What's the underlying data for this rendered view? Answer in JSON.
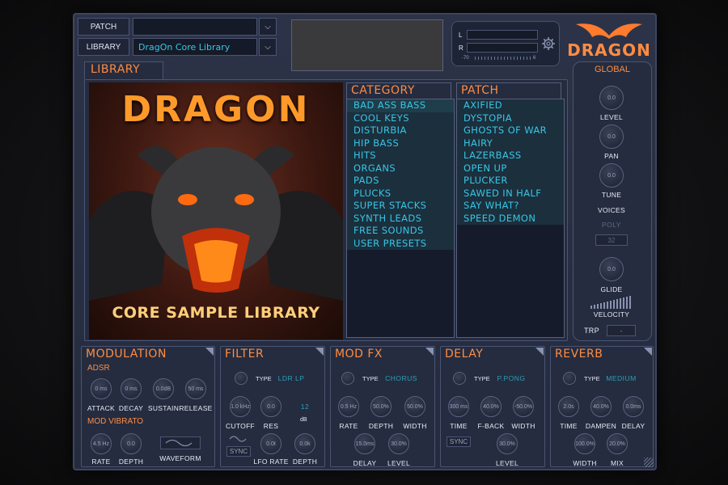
{
  "header": {
    "patch_label": "PATCH",
    "library_label": "LIBRARY",
    "patch_value": "",
    "library_value": "DragOn Core Library",
    "dropdown_glyph": "⌵",
    "meter_L": "L",
    "meter_R": "R",
    "meter_scale_low": "-70",
    "meter_scale_high": "6",
    "logo_text": "DRAGON"
  },
  "library": {
    "section_title": "LIBRARY",
    "artwork_title": "DRAGON",
    "artwork_caption": "CORE SAMPLE LIBRARY"
  },
  "category": {
    "title": "CATEGORY",
    "items": [
      "BAD ASS BASS",
      "COOL KEYS",
      "DISTURBIA",
      "HIP BASS",
      "HITS",
      "ORGANS",
      "PADS",
      "PLUCKS",
      "SUPER STACKS",
      "SYNTH LEADS",
      "FREE SOUNDS",
      "USER PRESETS"
    ],
    "selected_index": 0
  },
  "patch": {
    "title": "PATCH",
    "items": [
      "AXIFIED",
      "DYSTOPIA",
      "GHOSTS OF WAR",
      "HAIRY",
      "LAZERBASS",
      "OPEN UP",
      "PLUCKER",
      "SAWED IN HALF",
      "SAY WHAT?",
      "SPEED DEMON"
    ]
  },
  "global": {
    "title": "GLOBAL",
    "level_label": "LEVEL",
    "level_value": "0.0",
    "pan_label": "PAN",
    "pan_value": "0.0",
    "tune_label": "TUNE",
    "tune_value": "0.0",
    "voices_label": "VOICES",
    "voices_mode": "POLY",
    "voices_count": "32",
    "glide_label": "GLIDE",
    "glide_value": "0.0",
    "velocity_label": "VELOCITY",
    "trp_label": "TRP",
    "trp_value": "-"
  },
  "modulation": {
    "title": "MODULATION",
    "adsr_title": "ADSR",
    "attack_label": "ATTACK",
    "attack_value": "0 ms",
    "decay_label": "DECAY",
    "decay_value": "0 ms",
    "sustain_label": "SUSTAIN",
    "sustain_value": "0.0dB",
    "release_label": "RELEASE",
    "release_value": "50 ms",
    "vibrato_title": "MOD VIBRATO",
    "rate_label": "RATE",
    "rate_value": "4.5 Hz",
    "depth_label": "DEPTH",
    "depth_value": "0.0",
    "waveform_label": "WAVEFORM"
  },
  "filter": {
    "title": "FILTER",
    "type_label": "TYPE",
    "type_value": "LDR LP",
    "cutoff_label": "CUTOFF",
    "cutoff_value": "1.0 kHz",
    "res_label": "RES",
    "res_value": "0.0",
    "db_value": "12",
    "db_label": "dB",
    "sync_label": "SYNC",
    "lfo_rate_label": "LFO RATE",
    "lfo_rate_value": "0.0t",
    "depth_label": "DEPTH",
    "depth_value": "0.0k"
  },
  "modfx": {
    "title": "MOD FX",
    "type_label": "TYPE",
    "type_value": "CHORUS",
    "rate_label": "RATE",
    "rate_value": "0.5 Hz",
    "depth_label": "DEPTH",
    "depth_value": "50.0%",
    "width_label": "WIDTH",
    "width_value": "50.0%",
    "delay_label": "DELAY",
    "delay_value": "15.0ms",
    "level_label": "LEVEL",
    "level_value": "30.0%"
  },
  "delay": {
    "title": "DELAY",
    "type_label": "TYPE",
    "type_value": "P.PONG",
    "time_label": "TIME",
    "time_value": "300 ms",
    "fback_label": "F-BACK",
    "fback_value": "40.0%",
    "width_label": "WIDTH",
    "width_value": "-50.0%",
    "sync_label": "SYNC",
    "level_label": "LEVEL",
    "level_value": "30.0%"
  },
  "reverb": {
    "title": "REVERB",
    "type_label": "TYPE",
    "type_value": "MEDIUM",
    "time_label": "TIME",
    "time_value": "2.0s",
    "dampen_label": "DAMPEN",
    "dampen_value": "40.0%",
    "delay_label": "DELAY",
    "delay_value": "0.0ms",
    "width_label": "WIDTH",
    "width_value": "100.0%",
    "mix_label": "MIX",
    "mix_value": "20.0%"
  },
  "colors": {
    "accent_orange": "#ff8c42",
    "list_cyan": "#37c6e6",
    "panel_bg": "#252c3f"
  }
}
